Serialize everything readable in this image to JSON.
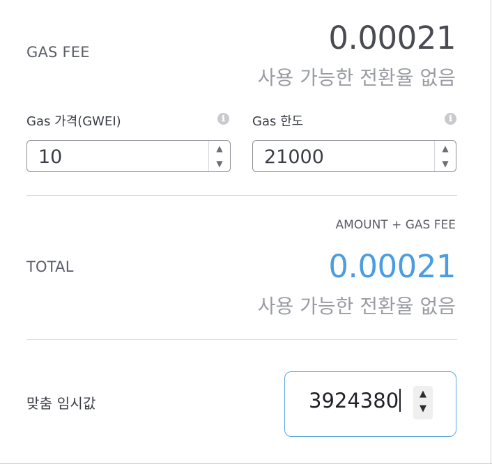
{
  "gas_fee": {
    "label": "GAS FEE",
    "value": "0.00021",
    "conversion": "사용 가능한 전환율 없음"
  },
  "gas_price": {
    "label": "Gas 가격(GWEI)",
    "value": "10"
  },
  "gas_limit": {
    "label": "Gas 한도",
    "value": "21000"
  },
  "total": {
    "caption": "AMOUNT + GAS FEE",
    "label": "TOTAL",
    "value": "0.00021",
    "conversion": "사용 가능한 전환율 없음"
  },
  "custom_nonce": {
    "label": "맞춤 임시값",
    "value": "3924380"
  },
  "icons": {
    "info": "ℹ",
    "spin_up": "▲",
    "spin_down": "▼"
  },
  "colors": {
    "total_value": "#4a9de0",
    "gas_fee_value": "#4a4b52",
    "focus_border": "#5ea5dd"
  }
}
